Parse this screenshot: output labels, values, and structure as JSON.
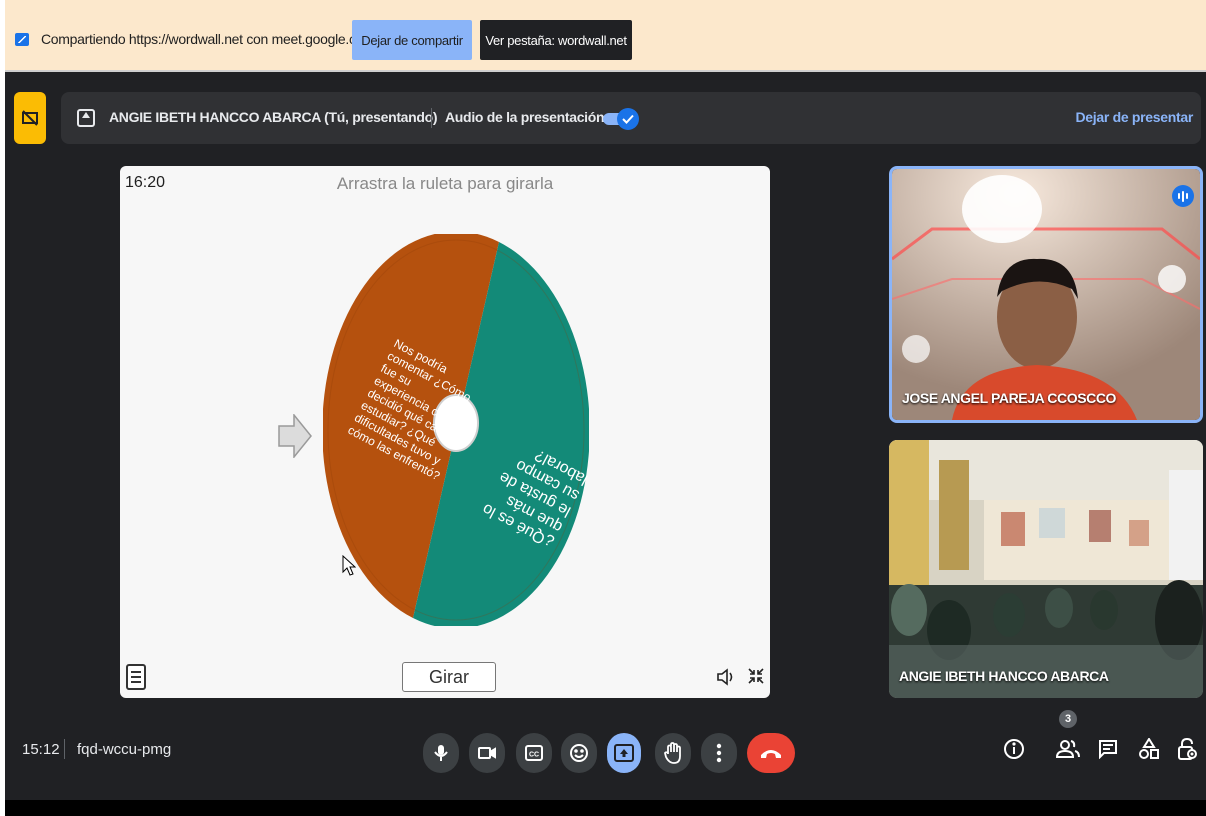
{
  "share_bar": {
    "text": "Compartiendo https://wordwall.net con meet.google.com",
    "stop_share_label": "Dejar de compartir",
    "view_tab_label": "Ver pestaña: wordwall.net"
  },
  "presenting_bar": {
    "presenter": "ANGIE IBETH HANCCO ABARCA (Tú, presentando)",
    "audio_label": "Audio de la presentación",
    "audio_enabled": true,
    "stop_present_label": "Dejar de presentar"
  },
  "activity": {
    "timer": "16:20",
    "instruction": "Arrastra la ruleta para girarla",
    "spin_label": "Girar",
    "segments": [
      {
        "color": "#b5510e",
        "lines": [
          "Nos podría",
          "comentar ¿Cómo",
          "fue su",
          "experiencia cuando",
          "decidió qué carrera",
          "estudiar? ¿Qué",
          "dificultades tuvo y",
          "cómo las enfrentó?"
        ]
      },
      {
        "color": "#138a78",
        "lines": [
          "¿Qué es lo",
          "que más",
          "le gusta de",
          "su campo",
          "laboral?"
        ]
      }
    ]
  },
  "participants": [
    {
      "name": "JOSE ANGEL PAREJA CCOSCCO",
      "speaking": true
    },
    {
      "name": "ANGIE IBETH HANCCO ABARCA",
      "speaking": false
    }
  ],
  "footer": {
    "time": "15:12",
    "meeting_code": "fqd-wccu-pmg",
    "participant_count": "3"
  },
  "colors": {
    "meet_bg": "#202124",
    "accent": "#8ab4f8",
    "end_call": "#ea4335",
    "share_bar_bg": "#fce8cc"
  },
  "icons": [
    "share-screen-icon",
    "present-off-icon",
    "mic-icon",
    "camera-icon",
    "captions-icon",
    "emoji-icon",
    "present-icon",
    "raise-hand-icon",
    "more-options-icon",
    "end-call-icon",
    "info-icon",
    "people-icon",
    "chat-icon",
    "activities-icon",
    "host-controls-icon",
    "sound-icon",
    "fullscreen-exit-icon",
    "menu-icon"
  ]
}
